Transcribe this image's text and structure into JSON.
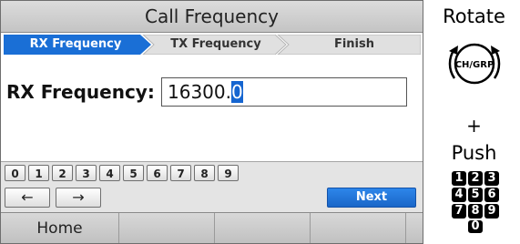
{
  "window": {
    "title": "Call Frequency"
  },
  "steps": [
    {
      "label": "RX Frequency",
      "active": true
    },
    {
      "label": "TX Frequency",
      "active": false
    },
    {
      "label": "Finish",
      "active": false
    }
  ],
  "field": {
    "label": "RX Frequency:",
    "value_prefix": "16300.",
    "value_cursor": "0"
  },
  "keypad": {
    "digits": [
      "0",
      "1",
      "2",
      "3",
      "4",
      "5",
      "6",
      "7",
      "8",
      "9"
    ],
    "left_arrow": "←",
    "right_arrow": "→",
    "next_label": "Next"
  },
  "softkeys": [
    {
      "label": "Home"
    },
    {
      "label": ""
    },
    {
      "label": ""
    },
    {
      "label": ""
    }
  ],
  "side": {
    "rotate_label": "Rotate",
    "knob_label": "CH/GRP",
    "plus_label": "+",
    "push_label": "Push",
    "push_keys": [
      "1",
      "2",
      "3",
      "4",
      "5",
      "6",
      "7",
      "8",
      "9",
      "0"
    ]
  },
  "colors": {
    "active_step": "#1a6fd6",
    "idle_step": "#e0e0e0",
    "accent": "#1565d0"
  },
  "icons": {
    "knob": "rotary-knob-icon",
    "arrows": "rotate-arrows-icon"
  }
}
